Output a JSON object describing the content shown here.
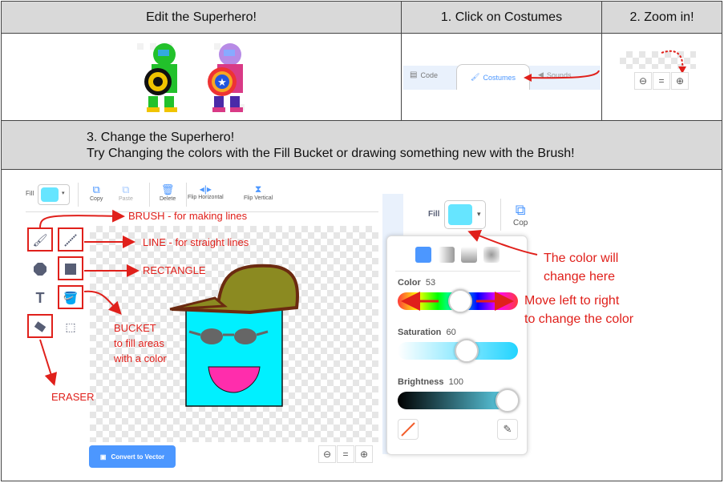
{
  "header": {
    "col1": "Edit the Superhero!",
    "col2": "1. Click on Costumes",
    "col3": "2. Zoom in!",
    "step3_line1": "3. Change the Superhero!",
    "step3_line2": "Try Changing the colors with the Fill Bucket or drawing something new with the Brush!"
  },
  "tabs": {
    "code": "Code",
    "costumes": "Costumes",
    "sounds": "Sounds"
  },
  "zoom": {
    "out": "−",
    "reset": "=",
    "in": "+"
  },
  "toolbar": {
    "fill_label": "Fill",
    "copy": "Copy",
    "paste": "Paste",
    "delete": "Delete",
    "flip_h": "Flip Horizontal",
    "flip_v": "Flip Vertical",
    "copy_short": "Cop"
  },
  "annotations": {
    "brush": "BRUSH - for making lines",
    "line": "LINE - for straight lines",
    "rect": "RECTANGLE",
    "bucket_1": "BUCKET",
    "bucket_2": "to fill areas",
    "bucket_3": "with a color",
    "eraser": "ERASER",
    "color_change_1": "The color will",
    "color_change_2": "change here",
    "move_1": "Move left to right",
    "move_2": "to change the color"
  },
  "convert_button": "Convert to Vector",
  "picker": {
    "color_label": "Color",
    "color_value": "53",
    "saturation_label": "Saturation",
    "saturation_value": "60",
    "brightness_label": "Brightness",
    "brightness_value": "100",
    "fill_color": "#66e5ff"
  },
  "colors": {
    "accent": "#4c97ff",
    "annotation_red": "#e0201b",
    "header_bg": "#d9d9d9"
  }
}
